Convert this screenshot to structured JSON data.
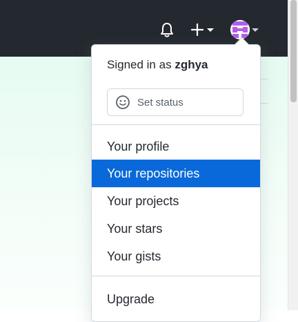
{
  "header": {
    "icons": {
      "notifications": "bell-icon",
      "create": "plus-icon",
      "create_caret": "caret-down-icon",
      "avatar_caret": "caret-down-icon"
    }
  },
  "dropdown": {
    "signed_in_prefix": "Signed in as",
    "username": "zghya",
    "status": {
      "label": "Set status",
      "icon": "smiley-icon"
    },
    "items": [
      {
        "label": "Your profile",
        "active": false
      },
      {
        "label": "Your repositories",
        "active": true
      },
      {
        "label": "Your projects",
        "active": false
      },
      {
        "label": "Your stars",
        "active": false
      },
      {
        "label": "Your gists",
        "active": false
      }
    ],
    "upgrade_label": "Upgrade"
  },
  "colors": {
    "topbar": "#24292f",
    "accent": "#0969da",
    "page_background": "#e6fbf1",
    "avatar": "#b45ee6"
  }
}
